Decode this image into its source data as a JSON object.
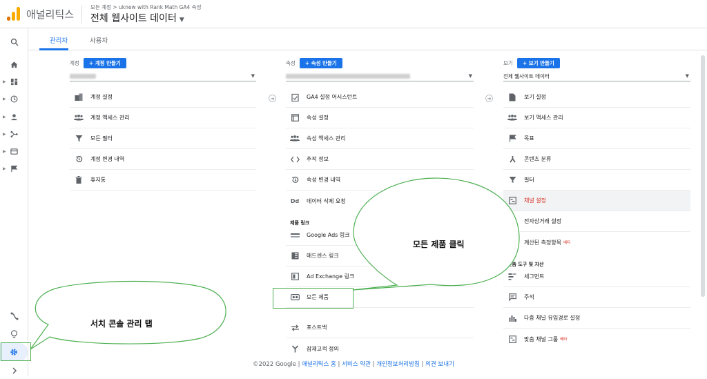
{
  "header": {
    "brand": "애널리틱스",
    "breadcrumb": "모든 계정 > uknew with Rank Math GA4 속성",
    "view_title": "전체 웹사이트 데이터"
  },
  "tabs": [
    {
      "label": "관리자"
    },
    {
      "label": "사용자"
    }
  ],
  "account": {
    "label": "계정",
    "create_button": "+ 계정 만들기",
    "items": [
      {
        "label": "계정 설정",
        "icon": "building-icon"
      },
      {
        "label": "계정 액세스 관리",
        "icon": "people-icon"
      },
      {
        "label": "모든 필터",
        "icon": "filter-icon"
      },
      {
        "label": "계정 변경 내역",
        "icon": "history-icon"
      },
      {
        "label": "휴지통",
        "icon": "trash-icon"
      }
    ]
  },
  "property": {
    "label": "속성",
    "create_button": "+ 속성 만들기",
    "items": [
      {
        "label": "GA4 설정 어시스턴트",
        "icon": "checklist-icon"
      },
      {
        "label": "속성 설정",
        "icon": "window-icon"
      },
      {
        "label": "속성 액세스 관리",
        "icon": "people-icon"
      },
      {
        "label": "추적 정보",
        "icon": "code-icon"
      },
      {
        "label": "속성 변경 내역",
        "icon": "history-icon"
      },
      {
        "label": "데이터 삭제 요청",
        "icon": "dd-icon"
      }
    ],
    "product_links_label": "제품 링크",
    "product_links": [
      {
        "label": "Google Ads 링크",
        "icon": "ads-icon"
      },
      {
        "label": "애드센스 링크",
        "icon": "adsense-icon"
      },
      {
        "label": "Ad Exchange 링크",
        "icon": "adexchange-icon"
      },
      {
        "label": "모든 제품",
        "icon": "all-products-icon"
      }
    ],
    "more_items": [
      {
        "label": "포스트백",
        "icon": "postback-icon"
      },
      {
        "label": "잠재고객 정의",
        "icon": "audience-icon"
      }
    ]
  },
  "view": {
    "label": "보기",
    "create_button": "+ 보기 만들기",
    "selected_view": "전체 웹사이트 데이터",
    "items": [
      {
        "label": "보기 설정",
        "icon": "doc-icon"
      },
      {
        "label": "보기 액세스 관리",
        "icon": "people-icon"
      },
      {
        "label": "목표",
        "icon": "flag-icon"
      },
      {
        "label": "콘텐츠 분류",
        "icon": "person-run-icon"
      },
      {
        "label": "필터",
        "icon": "filter-icon"
      },
      {
        "label": "채널 설정",
        "icon": "channel-icon"
      },
      {
        "label": "전자상거래 설정",
        "icon": "cart-icon"
      },
      {
        "label": "계산된 측정항목",
        "icon": "dd-icon",
        "badge": "베타"
      }
    ],
    "tools_label": "맞춤 도구 및 자산",
    "tools": [
      {
        "label": "세그먼트",
        "icon": "segment-icon"
      },
      {
        "label": "주석",
        "icon": "comment-icon"
      },
      {
        "label": "다중 채널 유입경로 설정",
        "icon": "bar-chart-icon"
      },
      {
        "label": "맞춤 채널 그룹",
        "icon": "channel-icon",
        "badge": "베타"
      }
    ]
  },
  "footer": {
    "copyright": "©2022 Google |",
    "home": "애널리틱스 홈",
    "terms": "서비스 약관",
    "privacy": "개인정보처리방침",
    "feedback": "의견 보내기",
    "sep": "|"
  },
  "annotations": {
    "bubble1": "모든 제품 클릭",
    "bubble2": "서치 콘솔 관리 탭"
  }
}
